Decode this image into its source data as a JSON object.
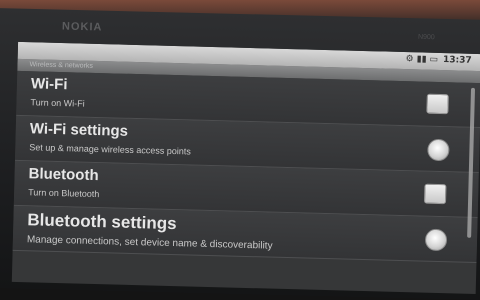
{
  "device": {
    "brand": "NOKIA",
    "model": "N900"
  },
  "statusbar": {
    "time": "13:37",
    "icons": [
      "notification-icon",
      "signal-icon",
      "battery-icon"
    ]
  },
  "section_header": "Wireless & networks",
  "settings": [
    {
      "title": "Wi-Fi",
      "summary": "Turn on Wi-Fi",
      "control": "checkbox"
    },
    {
      "title": "Wi-Fi settings",
      "summary": "Set up & manage wireless access points",
      "control": "radio"
    },
    {
      "title": "Bluetooth",
      "summary": "Turn on Bluetooth",
      "control": "checkbox"
    },
    {
      "title": "Bluetooth settings",
      "summary": "Manage connections, set device name & discoverability",
      "control": "radio"
    }
  ]
}
